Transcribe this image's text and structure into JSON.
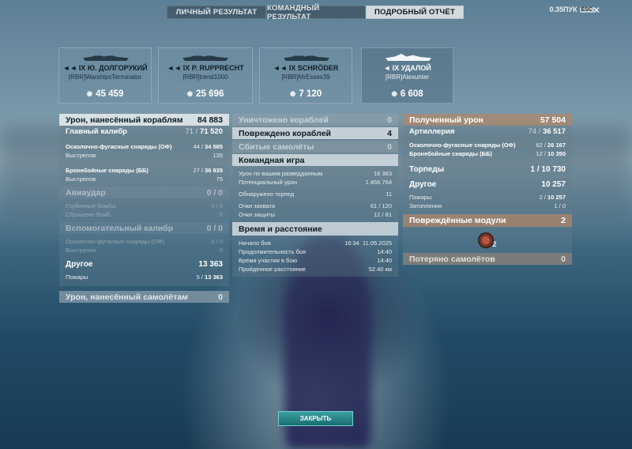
{
  "tabs": [
    {
      "label": "ЛИЧНЫЙ РЕЗУЛЬТАТ",
      "active": false
    },
    {
      "label": "КОМАНДНЫЙ РЕЗУЛЬТАТ",
      "active": false
    },
    {
      "label": "ПОДРОБНЫЙ ОТЧЁТ",
      "active": true
    }
  ],
  "top_right": {
    "label": "0.35ПУК",
    "esc": "ESC",
    "close": "✕"
  },
  "ships": [
    {
      "ship": "◄◄ IX Ю. ДОЛГОРУКИЙ",
      "player": "[RBR]WarshipsTerminator",
      "score": "45 459"
    },
    {
      "ship": "◄◄ IX P. RUPPRECHT",
      "player": "[RBR]trend1000",
      "score": "25 696"
    },
    {
      "ship": "◄◄ IX SCHRÖDER",
      "player": "[RBR]MrEssex39",
      "score": "7 120"
    },
    {
      "ship": "◄ IX УДАЛОЙ",
      "player": "[RBR]Alexunter",
      "score": "6 608"
    }
  ],
  "left": {
    "damage_ships": {
      "label": "Урон, нанесённый кораблям",
      "value": "84 883"
    },
    "main_battery": {
      "label": "Главный калибр",
      "value": "71 / ",
      "value_b": "71 520"
    },
    "he_shells": {
      "label": "Осколочно-фугасные снаряды (ОФ)",
      "value": "44 / ",
      "value_b": "34 585"
    },
    "he_shots": {
      "label": "Выстрелов",
      "value": "135"
    },
    "ap_shells": {
      "label": "Бронебойные снаряды (ББ)",
      "value": "27 / ",
      "value_b": "36 935"
    },
    "ap_shots": {
      "label": "Выстрелов",
      "value": "75"
    },
    "air_strike": {
      "label": "Авиаудар",
      "value": "0 / 0"
    },
    "depth_charges": {
      "label": "Глубинные бомбы",
      "value": "0 / 0"
    },
    "bombs_dropped": {
      "label": "Сброшено бомб",
      "value": "0"
    },
    "secondary": {
      "label": "Вспомогательный калибр",
      "value": "0 / 0"
    },
    "sec_he": {
      "label": "Осколочно-фугасные снаряды (ОФ)",
      "value": "0 / 0"
    },
    "sec_shots": {
      "label": "Выстрелов",
      "value": "0"
    },
    "other": {
      "label": "Другое",
      "value": "13 363"
    },
    "fires": {
      "label": "Пожары",
      "value": "5 / ",
      "value_b": "13 363"
    },
    "damage_planes": {
      "label": "Урон, нанесённый самолётам",
      "value": "0"
    }
  },
  "middle": {
    "destroyed": {
      "label": "Уничтожено кораблей",
      "value": "0"
    },
    "damaged": {
      "label": "Повреждено кораблей",
      "value": "4"
    },
    "planes_shot": {
      "label": "Сбитые самолёты",
      "value": "0"
    },
    "team_game": {
      "label": "Командная игра"
    },
    "spotting_damage": {
      "label": "Урон по вашим разведданным",
      "value": "16 383"
    },
    "potential_damage": {
      "label": "Потенциальный урон",
      "value": "1 456 764"
    },
    "torpedoes_spotted": {
      "label": "Обнаружено торпед",
      "value": "11"
    },
    "capture_points": {
      "label": "Очки захвата",
      "value": "61 / 120"
    },
    "defense_points": {
      "label": "Очки защиты",
      "value": "12 / 81"
    },
    "time_distance": {
      "label": "Время и расстояние"
    },
    "battle_start": {
      "label": "Начало боя",
      "time": "16:34",
      "date": "11.05.2025"
    },
    "battle_duration": {
      "label": "Продолжительность боя",
      "value": "14:40"
    },
    "participation": {
      "label": "Время участия в бою",
      "value": "14:40"
    },
    "distance": {
      "label": "Пройденное расстояние",
      "value": "52.40 км"
    }
  },
  "right": {
    "received": {
      "label": "Полученный урон",
      "value": "57 504"
    },
    "artillery": {
      "label": "Артиллерия",
      "value": "74 / ",
      "value_b": "36 517"
    },
    "he_shells": {
      "label": "Осколочно-фугасные снаряды (ОФ)",
      "value": "62 / ",
      "value_b": "26 167"
    },
    "ap_shells": {
      "label": "Бронебойные снаряды (ББ)",
      "value": "12 / ",
      "value_b": "10 350"
    },
    "torpedoes": {
      "label": "Торпеды",
      "value": "1 / 10 730"
    },
    "other": {
      "label": "Другое",
      "value": "10 257"
    },
    "fires": {
      "label": "Пожары",
      "value": "2 / ",
      "value_b": "10 257"
    },
    "flooding": {
      "label": "Затопления",
      "value": "1 / 0"
    },
    "modules": {
      "label": "Повреждённые модули",
      "value": "2",
      "icon_count": "2"
    },
    "planes_lost": {
      "label": "Потеряно самолётов",
      "value": "0"
    }
  },
  "close_button": {
    "label": "ЗАКРЫТЬ"
  }
}
